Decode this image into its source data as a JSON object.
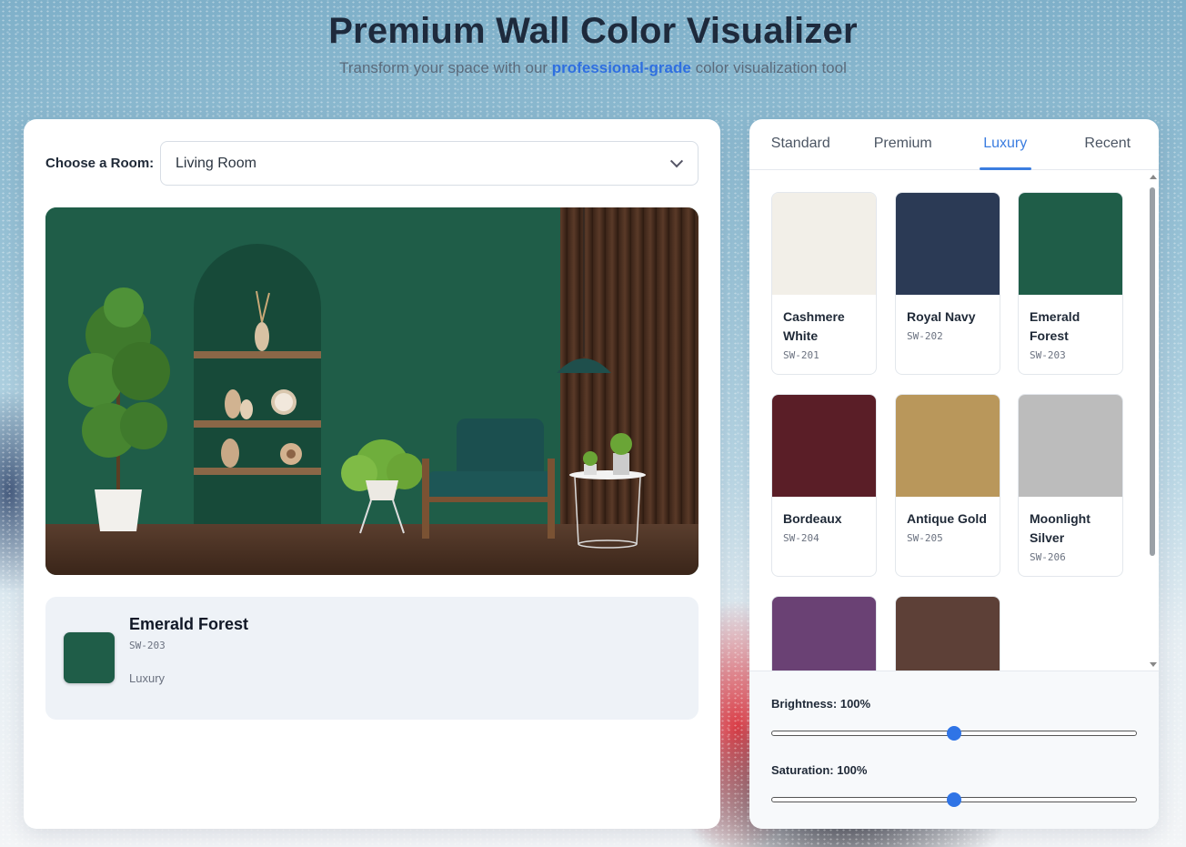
{
  "header": {
    "title": "Premium Wall Color Visualizer",
    "subtitle_before": "Transform your space with our ",
    "subtitle_accent": "professional-grade",
    "subtitle_after": " color visualization tool"
  },
  "room": {
    "label": "Choose a Room:",
    "selected": "Living Room"
  },
  "selected_color": {
    "name": "Emerald Forest",
    "code": "SW-203",
    "tier": "Luxury",
    "hex": "#1f5d48"
  },
  "tabs": [
    {
      "label": "Standard",
      "active": false
    },
    {
      "label": "Premium",
      "active": false
    },
    {
      "label": "Luxury",
      "active": true
    },
    {
      "label": "Recent",
      "active": false
    }
  ],
  "swatches": [
    {
      "name": "Cashmere White",
      "code": "SW-201",
      "hex": "#f2efe8"
    },
    {
      "name": "Royal Navy",
      "code": "SW-202",
      "hex": "#2b3a55"
    },
    {
      "name": "Emerald Forest",
      "code": "SW-203",
      "hex": "#1f5d48"
    },
    {
      "name": "Bordeaux",
      "code": "SW-204",
      "hex": "#5a1e27"
    },
    {
      "name": "Antique Gold",
      "code": "SW-205",
      "hex": "#b9975b"
    },
    {
      "name": "Moonlight Silver",
      "code": "SW-206",
      "hex": "#bcbcbc"
    },
    {
      "name": "",
      "code": "",
      "hex": "#6a4174"
    },
    {
      "name": "",
      "code": "",
      "hex": "#5d4037"
    }
  ],
  "controls": {
    "brightness_label": "Brightness: 100%",
    "brightness_value": 0.5,
    "saturation_label": "Saturation: 100%",
    "saturation_value": 0.5
  }
}
